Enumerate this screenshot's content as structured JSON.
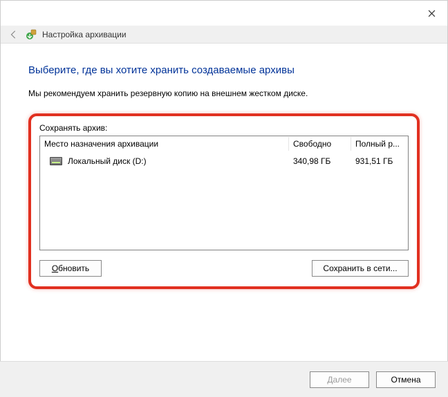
{
  "window": {
    "title": "Настройка архивации"
  },
  "main": {
    "heading": "Выберите, где вы хотите хранить создаваемые архивы",
    "recommendation": "Мы рекомендуем хранить резервную копию на внешнем жестком диске."
  },
  "section": {
    "label": "Сохранять архив:",
    "columns": {
      "destination": "Место назначения архивации",
      "free": "Свободно",
      "full": "Полный р..."
    },
    "rows": [
      {
        "name": "Локальный диск (D:)",
        "free": "340,98 ГБ",
        "full": "931,51 ГБ"
      }
    ],
    "refresh_label": "Обновить",
    "network_label": "Сохранить в сети..."
  },
  "footer": {
    "next": "Далее",
    "cancel": "Отмена"
  }
}
